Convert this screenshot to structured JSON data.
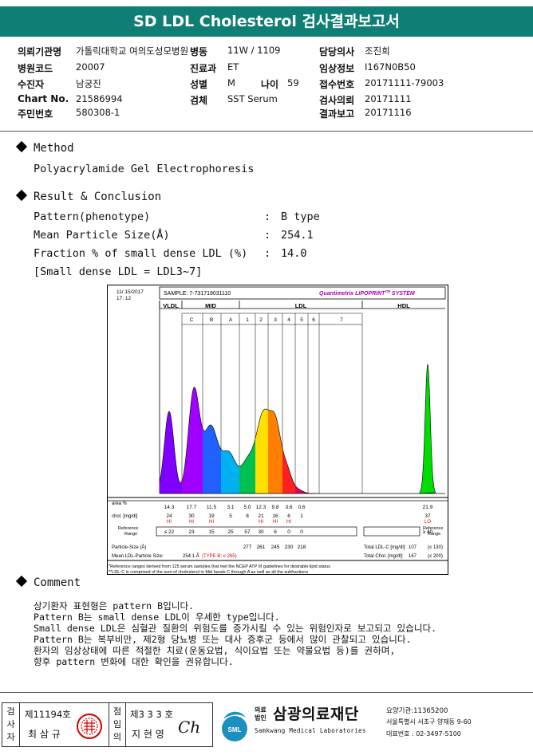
{
  "title": "SD LDL Cholesterol 검사결과보고서",
  "info": {
    "hospital_label": "의뢰기관명",
    "hospital_value": "가톨릭대학교 여의도성모병원",
    "ward_label": "병동",
    "ward_value": "11W / 1109",
    "doctor_label": "담당의사",
    "doctor_value": "조진희",
    "code_label": "병원코드",
    "code_value": "20007",
    "dept_label": "진료과",
    "dept_value": "ET",
    "insurance_label": "임상정보",
    "insurance_value": "I167N0B50",
    "patient_label": "수진자",
    "patient_value": "남궁진",
    "sex_label": "성별",
    "sex_value": "M",
    "age_label": "나이",
    "age_value": "59",
    "receipt_label": "접수번호",
    "receipt_value": "20171111-79003",
    "chart_label": "Chart No.",
    "chart_value": "21586994",
    "specimen_label": "검체",
    "specimen_value": "SST Serum",
    "request_label": "검사의뢰",
    "request_value": "20171111",
    "resident_label": "주민번호",
    "resident_value": "580308-1",
    "report_label": "결과보고",
    "report_value": "20171116"
  },
  "method": {
    "heading": "Method",
    "text": "Polyacrylamide Gel Electrophoresis"
  },
  "result": {
    "heading": "Result & Conclusion",
    "rows": [
      {
        "label": "Pattern(phenotype)",
        "sep": ":",
        "value": "B type"
      },
      {
        "label": "Mean Particle Size(Å)",
        "sep": ":",
        "value": "254.1"
      },
      {
        "label": "Fraction % of small dense LDL (%)",
        "sep": ":",
        "value": "14.0"
      }
    ],
    "note": "[Small dense LDL = LDL3~7]"
  },
  "chart_data": {
    "type": "area",
    "header_date": "11/ 15/2017",
    "header_time": "17: 12",
    "sample": "SAMPLE:  7-731719031110",
    "brand": "Quantimetrix LIPOPRINT",
    "brand_tm": "TM",
    "brand_sys": " SYSTEM",
    "groups": [
      "VLDL",
      "MID",
      "LDL",
      "HDL"
    ],
    "bands": [
      "C",
      "B",
      "A",
      "1",
      "2",
      "3",
      "4",
      "5",
      "6",
      "7"
    ],
    "area_label": "area %",
    "area": [
      "14.3",
      "17.7",
      "11.5",
      "3.1",
      "5.0",
      "12.3",
      "9.8",
      "3.6",
      "0.6",
      "",
      "21.9"
    ],
    "chol_label": "chol. [mg/dl]",
    "chol": [
      "24",
      "30",
      "19",
      "5",
      "8",
      "21",
      "16",
      "6",
      "1",
      "",
      "37"
    ],
    "chol_flag": [
      "HI",
      "HI",
      "HI",
      "",
      "",
      "HI",
      "HI",
      "HI",
      "",
      "",
      "LO"
    ],
    "ref_label": [
      "Reference",
      "Range"
    ],
    "ref": [
      "≤ 22",
      "23",
      "15",
      "25",
      "57",
      "30",
      "6",
      "0",
      "0",
      "",
      "≥ 40"
    ],
    "ref_right": [
      "Reference",
      "Range"
    ],
    "ps_label": "Particle-Size (Å)",
    "ps": [
      "277",
      "261",
      "245",
      "230",
      "218"
    ],
    "mean_label": "Mean LDL-Particle Size:",
    "mean_value": "254.1 Å",
    "mean_type": "(TYPE B; ≤ 265)",
    "total_ldl_label": "Total LDL-C [mg/dl]:",
    "total_ldl": "107",
    "total_ldl_ref": "(≤ 130)",
    "total_chol_label": "Total Chol. [mg/dl]:",
    "total_chol": "167",
    "total_chol_ref": "(≤ 200)",
    "footnote1": "*Reference ranges derived from 125 serum samples that met the NCEP ATP III guidelines for desirable lipid status",
    "footnote2": "**LDL-C is comprised of the sum of cholesterol in Mid bands C through A as well as all the subfractions",
    "colors": {
      "vldl": "#8000ff",
      "mid": "#a000ff",
      "b": "#2060ff",
      "a": "#00b0f0",
      "l1": "#00c050",
      "l2": "#ffe000",
      "l3": "#ff8000",
      "l4": "#ff2020",
      "l5": "#e00060",
      "hdl": "#00dd00"
    }
  },
  "comment": {
    "heading": "Comment",
    "lines": [
      "상기환자 표현형은 pattern B입니다.",
      "Pattern B는 small dense LDL이 우세한 type입니다.",
      "Small dense LDL은 심혈관 질환의 위험도를 증가시킬 수 있는 위험인자로 보고되고 있습니다.",
      "Pattern B는 복부비만, 제2형 당뇨병 또는 대사 증후군 등에서 많이 관찰되고 있습니다.",
      "환자의 임상상태에 따른 적절한 치료(운동요법, 식이요법 또는 약물요법 등)를 권하며,",
      "향후 pattern 변화에 대한 확인을 권유합니다."
    ]
  },
  "footer": {
    "tester_label": [
      "검",
      "사",
      "자"
    ],
    "tester_no": "제11194호",
    "tester_name": "최 삼 규",
    "reviewer_label": [
      "점",
      "임",
      "의"
    ],
    "reviewer_no": "제3 3 3 호",
    "reviewer_name": "지 현 영",
    "signature": "Ch",
    "org_prefix1": "의료",
    "org_prefix2": "법인",
    "org_name": "삼광의료재단",
    "org_en": "Samkwang Medical Laboratories",
    "logo_text": "SML",
    "inst_no": "요양기관:11365200",
    "address": "서울특별시 서초구 양재동 9-60",
    "phone": "대표번호 : 02-3497-5100"
  }
}
